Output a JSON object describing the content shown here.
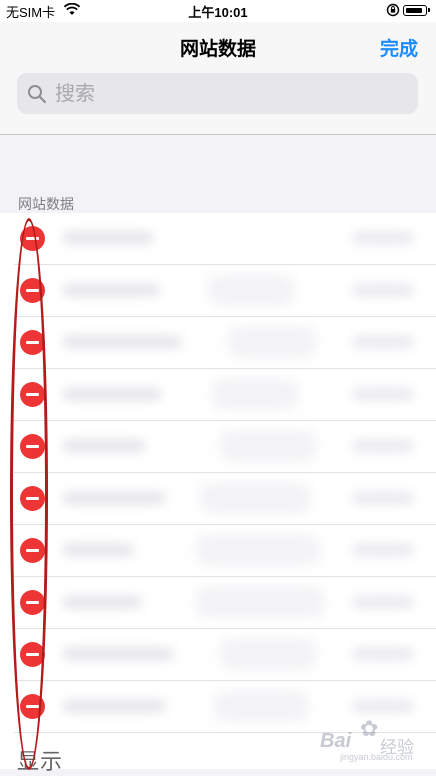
{
  "status_bar": {
    "carrier": "无SIM卡",
    "time": "上午10:01",
    "icons": [
      "wifi-icon",
      "orientation-lock-icon",
      "battery-icon"
    ]
  },
  "nav": {
    "title": "网站数据",
    "done_label": "完成"
  },
  "search": {
    "placeholder": "搜索",
    "value": ""
  },
  "section": {
    "header": "网站数据"
  },
  "rows": [
    {
      "delete_icon": "minus-circle-icon"
    },
    {
      "delete_icon": "minus-circle-icon"
    },
    {
      "delete_icon": "minus-circle-icon"
    },
    {
      "delete_icon": "minus-circle-icon"
    },
    {
      "delete_icon": "minus-circle-icon"
    },
    {
      "delete_icon": "minus-circle-icon"
    },
    {
      "delete_icon": "minus-circle-icon"
    },
    {
      "delete_icon": "minus-circle-icon"
    },
    {
      "delete_icon": "minus-circle-icon"
    },
    {
      "delete_icon": "minus-circle-icon"
    }
  ],
  "footer_partial_text": "显示",
  "watermark": {
    "brand": "Bai",
    "brand2": "经验",
    "url": "jingyan.baidu.com"
  },
  "colors": {
    "accent": "#1a8cff",
    "delete_red": "#ee3535",
    "annotation_red": "#b31a1a"
  }
}
